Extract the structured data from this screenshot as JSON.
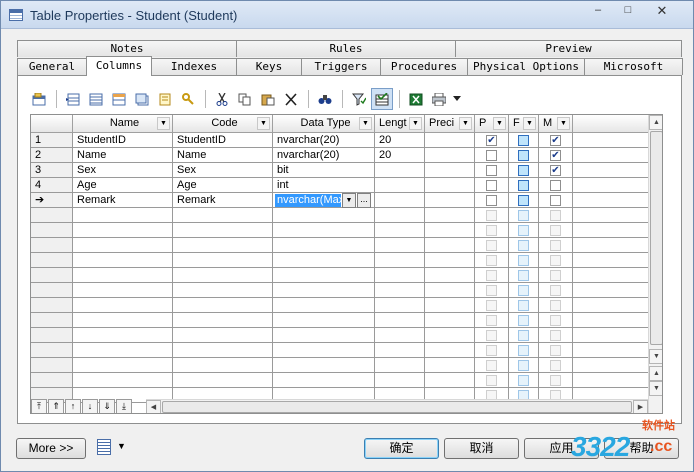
{
  "window": {
    "title": "Table Properties - Student (Student)",
    "minimize": "–",
    "maximize": "□",
    "close": "✕"
  },
  "tabs_back": [
    {
      "label": "Notes"
    },
    {
      "label": "Rules"
    },
    {
      "label": "Preview"
    }
  ],
  "tabs_front": [
    {
      "label": "General"
    },
    {
      "label": "Columns",
      "active": true
    },
    {
      "label": "Indexes"
    },
    {
      "label": "Keys"
    },
    {
      "label": "Triggers"
    },
    {
      "label": "Procedures"
    },
    {
      "label": "Physical Options"
    },
    {
      "label": "Microsoft"
    }
  ],
  "toolbar": {
    "icons": [
      "properties-icon",
      "insert-row-icon",
      "add-row-icon",
      "add-columns-icon",
      "reuse-columns-icon",
      "key-icon",
      "cut-icon",
      "copy-icon",
      "paste-icon",
      "delete-icon",
      "find-icon",
      "filter-icon",
      "customize-columns-icon",
      "excel-icon",
      "print-icon",
      "more-dropdown-icon"
    ]
  },
  "grid": {
    "headers": [
      "Name",
      "Code",
      "Data Type",
      "Lengt",
      "Preci",
      "P",
      "F",
      "M"
    ],
    "rows": [
      {
        "num": "1",
        "name": "StudentID",
        "code": "StudentID",
        "type": "nvarchar(20)",
        "length": "20",
        "p": true,
        "f": false,
        "m": true
      },
      {
        "num": "2",
        "name": "Name",
        "code": "Name",
        "type": "nvarchar(20)",
        "length": "20",
        "p": false,
        "f": false,
        "m": true
      },
      {
        "num": "3",
        "name": "Sex",
        "code": "Sex",
        "type": "bit",
        "length": "",
        "p": false,
        "f": false,
        "m": true
      },
      {
        "num": "4",
        "name": "Age",
        "code": "Age",
        "type": "int",
        "length": "",
        "p": false,
        "f": false,
        "m": false
      },
      {
        "num": "➔",
        "name": "Remark",
        "code": "Remark",
        "type": "nvarchar(Max)",
        "length": "",
        "p": false,
        "f": false,
        "m": false
      }
    ],
    "edit_dropdown": "▼",
    "edit_more": "..."
  },
  "nav": [
    "⤒",
    "⇑",
    "↑",
    "↓",
    "⇓",
    "⤓"
  ],
  "buttons": {
    "more": "More >>",
    "ok": "确定",
    "cancel": "取消",
    "apply": "应用",
    "help": "帮助"
  },
  "watermark": {
    "logo": "3322",
    "site": "软件站",
    "tld": ".cc"
  }
}
